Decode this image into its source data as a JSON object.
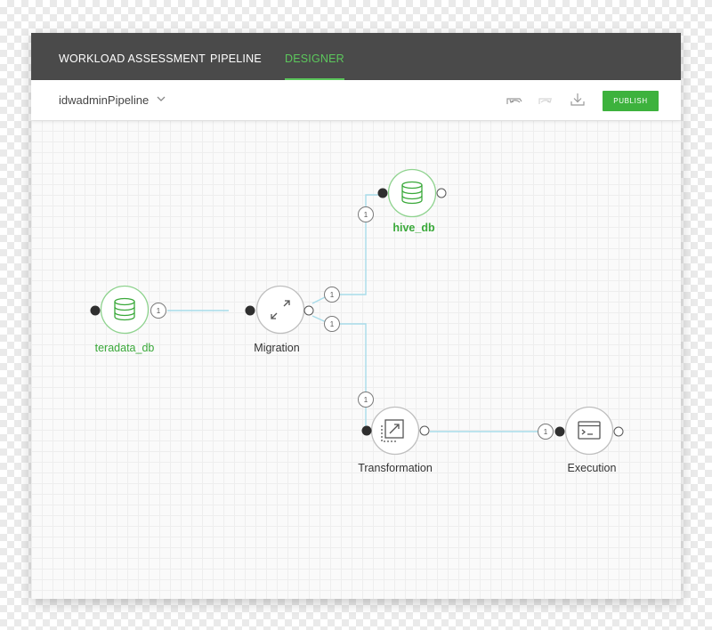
{
  "nav": {
    "tabs": [
      {
        "label": "WORKLOAD ASSESSMENT",
        "active": false
      },
      {
        "label": "PIPELINE",
        "active": false
      },
      {
        "label": "DESIGNER",
        "active": true
      }
    ]
  },
  "toolbar": {
    "pipeline_name": "idwadminPipeline",
    "icons": [
      "undo-icon",
      "redo-icon",
      "download-icon",
      "chevron-down-icon"
    ],
    "publish_label": "PUBLISH"
  },
  "nodes": {
    "teradata": {
      "label": "teradata_db",
      "icon": "database-icon"
    },
    "hive": {
      "label": "hive_db",
      "icon": "database-icon"
    },
    "migration": {
      "label": "Migration",
      "icon": "migration-arrows-icon"
    },
    "transformation": {
      "label": "Transformation",
      "icon": "transform-icon"
    },
    "execution": {
      "label": "Execution",
      "icon": "terminal-icon"
    }
  },
  "edge_badges": {
    "teradata_out": "1",
    "migration_in": "1",
    "migration_out_top": "1",
    "migration_out_bottom": "1",
    "hive_in": "1",
    "transformation_in": "1",
    "execution_in": "1"
  },
  "colors": {
    "nav_bg": "#4a4a4a",
    "accent_green": "#5cc85c",
    "publish_green": "#3db23d",
    "connector": "#a8dcea"
  }
}
